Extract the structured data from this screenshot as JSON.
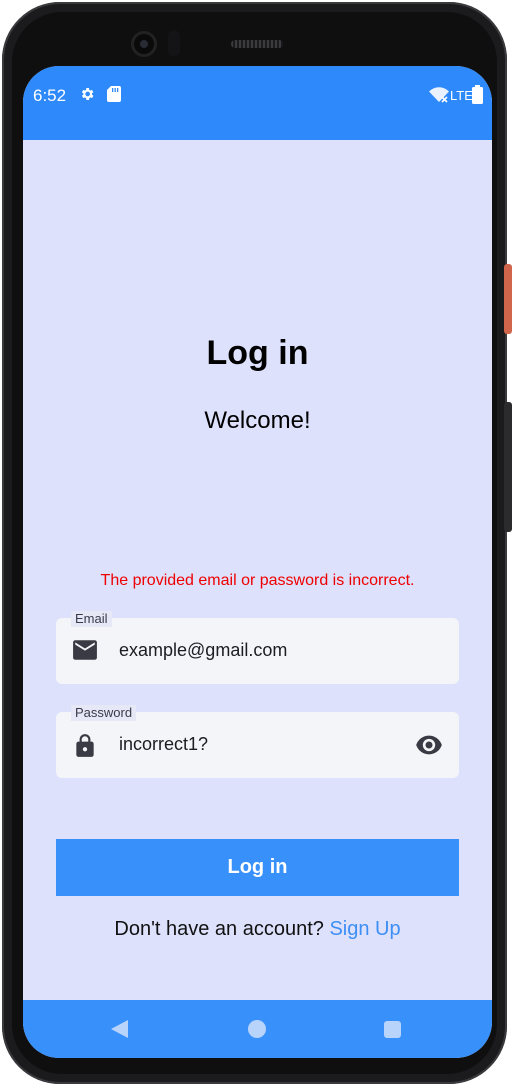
{
  "status_bar": {
    "time": "6:52",
    "network": "LTE"
  },
  "page": {
    "title": "Log in",
    "subtitle": "Welcome!",
    "error_message": "The provided email or password is incorrect."
  },
  "email_field": {
    "label": "Email",
    "value": "example@gmail.com",
    "icon": "mail-icon"
  },
  "password_field": {
    "label": "Password",
    "value": "incorrect1?",
    "icon": "lock-icon",
    "toggle_icon": "eye-icon"
  },
  "login_button": {
    "label": "Log in"
  },
  "signup": {
    "prompt": "Don't have an account?",
    "link": "Sign Up"
  },
  "colors": {
    "primary": "#3890fb",
    "status_bar": "#2e89fb",
    "background": "#dde1fc",
    "error": "#ee0000",
    "link": "#3d8ff5"
  }
}
